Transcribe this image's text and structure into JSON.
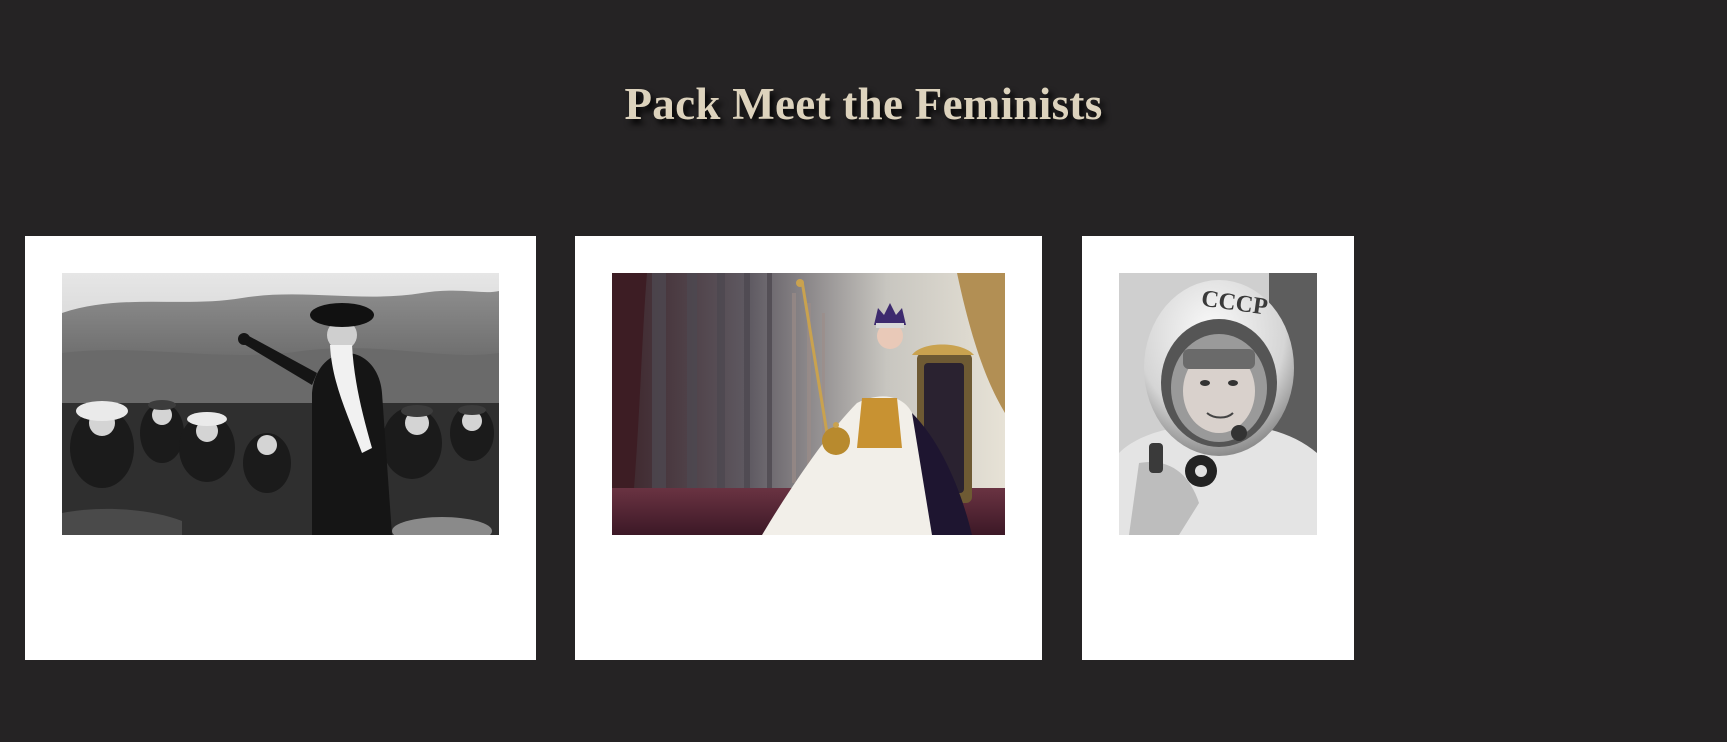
{
  "page": {
    "title": "Pack Meet the Feminists",
    "background_color": "#252324",
    "title_color": "#ddd3bd"
  },
  "cards": [
    {
      "image_name": "suffragette-speech-photo",
      "caption": ""
    },
    {
      "image_name": "queen-coronation-portrait",
      "caption": ""
    },
    {
      "image_name": "cosmonaut-helmet-photo",
      "caption": ""
    }
  ]
}
